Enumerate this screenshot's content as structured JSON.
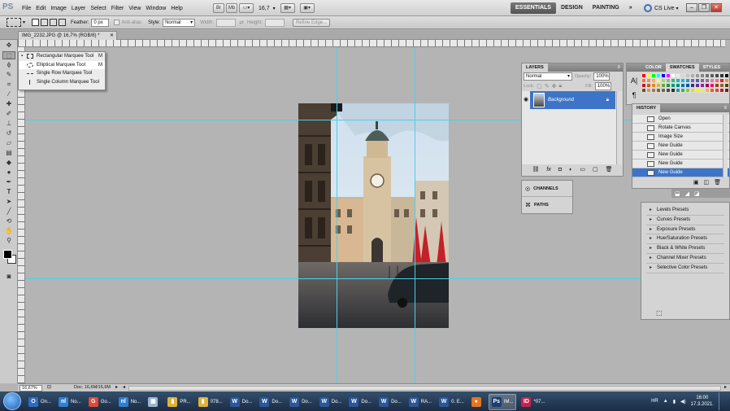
{
  "app": {
    "logo": "PS",
    "zoom": "16,7",
    "cs_live": "CS Live"
  },
  "menu": [
    "File",
    "Edit",
    "Image",
    "Layer",
    "Select",
    "Filter",
    "View",
    "Window",
    "Help"
  ],
  "workspaces": {
    "essentials": "ESSENTIALS",
    "design": "DESIGN",
    "painting": "PAINTING",
    "more": "»"
  },
  "options": {
    "feather_label": "Feather:",
    "feather_value": "0 px",
    "antialias": "Anti-alias",
    "style_label": "Style:",
    "style_value": "Normal",
    "width_label": "Width:",
    "height_label": "Height:",
    "refine": "Refine Edge..."
  },
  "document": {
    "tab": "IMG_2232.JPG @ 16,7% (RGB/8) *"
  },
  "flyout": {
    "items": [
      {
        "label": "Rectangular Marquee Tool",
        "key": "M"
      },
      {
        "label": "Elliptical Marquee Tool",
        "key": "M"
      },
      {
        "label": "Single Row Marquee Tool",
        "key": ""
      },
      {
        "label": "Single Column Marquee Tool",
        "key": ""
      }
    ]
  },
  "layers": {
    "tab": "LAYERS",
    "blend": "Normal",
    "opacity_label": "Opacity:",
    "opacity_value": "100%",
    "lock_label": "Lock:",
    "fill_label": "Fill:",
    "fill_value": "100%",
    "layer_name": "Background"
  },
  "channels": {
    "channels": "CHANNELS",
    "paths": "PATHS"
  },
  "color_panel": {
    "tabs": [
      "COLOR",
      "SWATCHES",
      "STYLES"
    ]
  },
  "history": {
    "tab": "HISTORY",
    "items": [
      "Open",
      "Rotate Canvas",
      "Image Size",
      "New Guide",
      "New Guide",
      "New Guide",
      "New Guide"
    ]
  },
  "adjustments": {
    "items": [
      "Levels Presets",
      "Curves Presets",
      "Exposure Presets",
      "Hue/Saturation Presets",
      "Black & White Presets",
      "Channel Mixer Presets",
      "Selective Color Presets"
    ]
  },
  "status": {
    "zoom": "16,67%",
    "doc": "Doc: 16,6M/16,6M"
  },
  "taskbar": {
    "items": [
      {
        "label": "On...",
        "color": "#2d6bc1",
        "glyph": "O"
      },
      {
        "label": "No...",
        "color": "#2f7fd0",
        "glyph": "nl"
      },
      {
        "label": "Go...",
        "color": "#dd4b39",
        "glyph": "G"
      },
      {
        "label": "No...",
        "color": "#2f7fd0",
        "glyph": "nl"
      },
      {
        "label": "",
        "color": "#9bb6d0",
        "glyph": "▦"
      },
      {
        "label": "PR...",
        "color": "#e0b23c",
        "glyph": "▮"
      },
      {
        "label": "078...",
        "color": "#e0b23c",
        "glyph": "▮"
      },
      {
        "label": "Do...",
        "color": "#2b579a",
        "glyph": "W"
      },
      {
        "label": "Do...",
        "color": "#2b579a",
        "glyph": "W"
      },
      {
        "label": "Do...",
        "color": "#2b579a",
        "glyph": "W"
      },
      {
        "label": "Do...",
        "color": "#2b579a",
        "glyph": "W"
      },
      {
        "label": "Do...",
        "color": "#2b579a",
        "glyph": "W"
      },
      {
        "label": "Do...",
        "color": "#2b579a",
        "glyph": "W"
      },
      {
        "label": "RA...",
        "color": "#2b579a",
        "glyph": "W"
      },
      {
        "label": "0. E...",
        "color": "#2b579a",
        "glyph": "W"
      },
      {
        "label": "",
        "color": "#e8741d",
        "glyph": "●"
      },
      {
        "label": "IM...",
        "color": "#1c3e6e",
        "glyph": "Ps"
      },
      {
        "label": "*07...",
        "color": "#c6224e",
        "glyph": "ID"
      }
    ],
    "lang": "HR",
    "time": "16:00",
    "date": "17.3.2021."
  }
}
